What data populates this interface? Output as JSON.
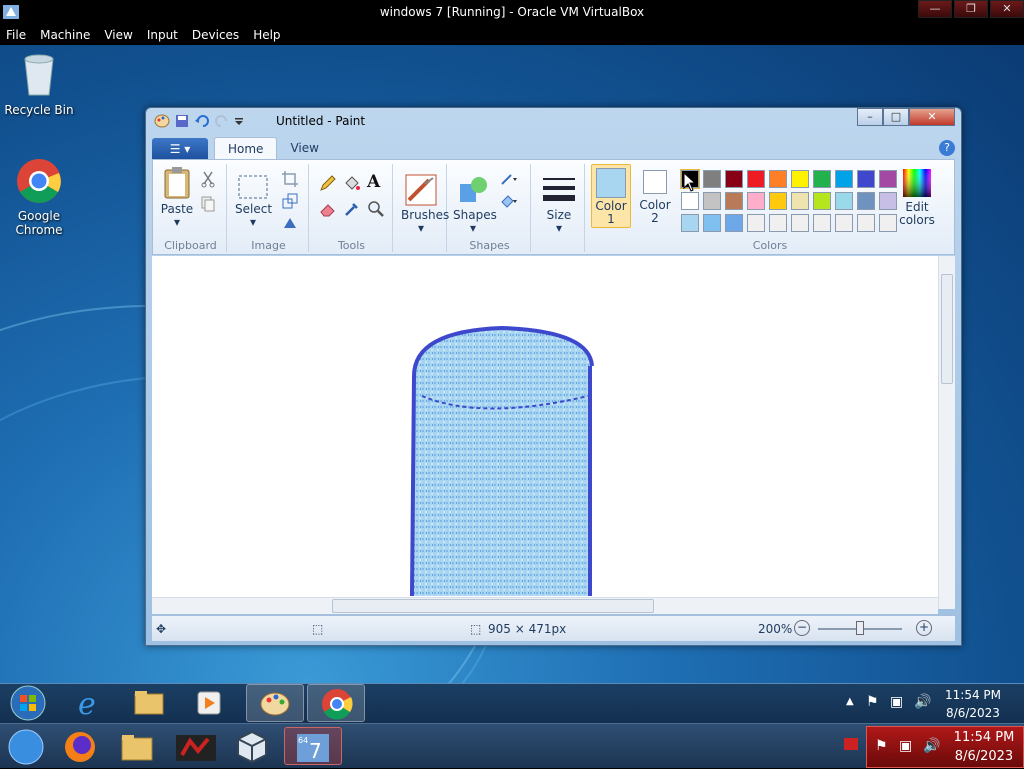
{
  "vbox": {
    "title": "windows 7 [Running] - Oracle VM VirtualBox",
    "menu": [
      "File",
      "Machine",
      "View",
      "Input",
      "Devices",
      "Help"
    ]
  },
  "desktop_icons": [
    {
      "label": "Recycle Bin",
      "icon": "recycle-bin-icon"
    },
    {
      "label": "Google Chrome",
      "icon": "chrome-icon"
    }
  ],
  "paint": {
    "title": "Untitled - Paint",
    "tabs": {
      "home": "Home",
      "view": "View"
    },
    "clipboard": {
      "paste": "Paste",
      "group": "Clipboard"
    },
    "image": {
      "select": "Select",
      "group": "Image"
    },
    "tools": {
      "group": "Tools",
      "text_glyph": "A"
    },
    "brushes": {
      "label": "Brushes"
    },
    "shapes": {
      "label": "Shapes",
      "group": "Shapes"
    },
    "size": {
      "label": "Size"
    },
    "colors": {
      "color1_line1": "Color",
      "color1_line2": "1",
      "color2_line1": "Color",
      "color2_line2": "2",
      "edit_line1": "Edit",
      "edit_line2": "colors",
      "group": "Colors",
      "color1_value": "#a8d6f0",
      "color2_value": "#ffffff",
      "palette_row1": [
        "#000000",
        "#7f7f7f",
        "#880015",
        "#ed1c24",
        "#ff7f27",
        "#fff200",
        "#22b14c",
        "#00a2e8",
        "#3f48cc",
        "#a349a4"
      ],
      "palette_row2": [
        "#ffffff",
        "#c3c3c3",
        "#b97a57",
        "#ffaec9",
        "#ffc90e",
        "#efe4b0",
        "#b5e61d",
        "#99d9ea",
        "#7092be",
        "#c8bfe7"
      ],
      "palette_row3": [
        "#a8d6f0",
        "#80c0f0",
        "#6ea8e8",
        "#f0f0f0",
        "#f0f0f0",
        "#f0f0f0",
        "#f0f0f0",
        "#f0f0f0",
        "#f0f0f0",
        "#f0f0f0"
      ]
    },
    "status": {
      "dimensions": "905 × 471px",
      "zoom": "200%"
    }
  },
  "taskbar_top": {
    "time": "11:54 PM",
    "date": "8/6/2023",
    "apps": [
      "start-orb",
      "internet-explorer",
      "windows-explorer",
      "media-player",
      "paint",
      "chrome"
    ]
  },
  "taskbar_bottom": {
    "time": "11:54 PM",
    "date": "8/6/2023",
    "apps": [
      "start-orb",
      "firefox",
      "file-manager",
      "game-app",
      "virtualbox",
      "windows7-vm"
    ]
  }
}
